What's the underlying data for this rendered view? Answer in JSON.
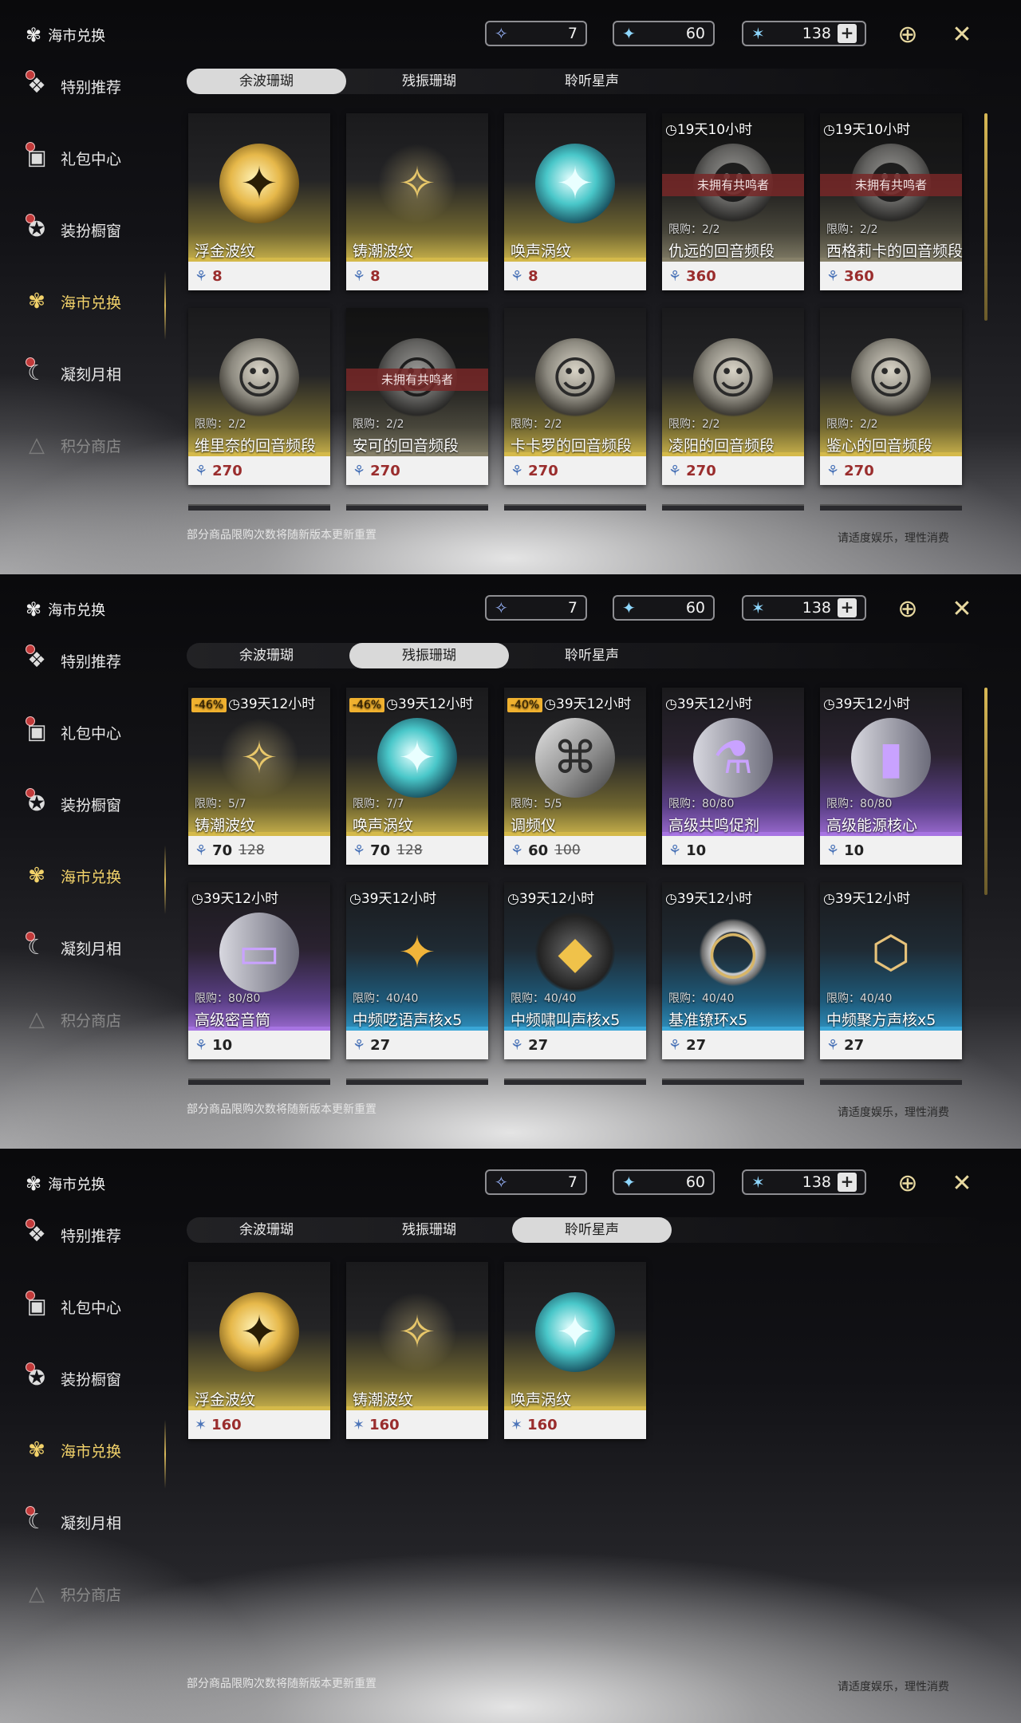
{
  "screens": [
    {
      "header": {
        "title": "海市兑换"
      },
      "sidebar": [
        {
          "label": "特别推荐",
          "badge": true,
          "active": false,
          "dim": false,
          "icon": "star-pack-icon"
        },
        {
          "label": "礼包中心",
          "badge": true,
          "active": false,
          "dim": false,
          "icon": "gift-icon"
        },
        {
          "label": "装扮橱窗",
          "badge": true,
          "active": false,
          "dim": false,
          "icon": "outfit-icon"
        },
        {
          "label": "海市兑换",
          "badge": false,
          "active": true,
          "dim": false,
          "icon": "coral-icon"
        },
        {
          "label": "凝刻月相",
          "badge": true,
          "active": false,
          "dim": false,
          "icon": "moon-icon"
        },
        {
          "label": "积分商店",
          "badge": false,
          "active": false,
          "dim": true,
          "icon": "triangle-icon"
        }
      ],
      "currencies": [
        "7",
        "60",
        "138"
      ],
      "tabs": [
        "余波珊瑚",
        "残振珊瑚",
        "聆听星声"
      ],
      "selected_tab": 0,
      "cards": [
        {
          "title": "浮金波纹",
          "price": "8",
          "style": "gold",
          "item": "orb-gold",
          "glyph": "✦"
        },
        {
          "title": "铸潮波纹",
          "price": "8",
          "style": "gold",
          "item": "orb-blade",
          "glyph": "✧"
        },
        {
          "title": "唤声涡纹",
          "price": "8",
          "style": "gold",
          "item": "orb-teal",
          "glyph": "✦"
        },
        {
          "title": "仇远的回音频段",
          "price": "360",
          "style": "gold",
          "item": "orb-portrait",
          "glyph": "☻",
          "timer": "19天10小时",
          "limit": "限购：2/2",
          "locked": "未拥有共鸣者"
        },
        {
          "title": "西格莉卡的回音频段",
          "price": "360",
          "style": "gold",
          "item": "orb-portrait",
          "glyph": "☻",
          "timer": "19天10小时",
          "limit": "限购：2/2",
          "locked": "未拥有共鸣者"
        },
        {
          "title": "维里奈的回音频段",
          "price": "270",
          "style": "gold",
          "item": "orb-portrait",
          "glyph": "☺",
          "limit": "限购：2/2"
        },
        {
          "title": "安可的回音频段",
          "price": "270",
          "style": "gold",
          "item": "orb-portrait",
          "glyph": "☺",
          "limit": "限购：2/2",
          "locked": "未拥有共鸣者"
        },
        {
          "title": "卡卡罗的回音频段",
          "price": "270",
          "style": "gold",
          "item": "orb-portrait",
          "glyph": "☺",
          "limit": "限购：2/2"
        },
        {
          "title": "凌阳的回音频段",
          "price": "270",
          "style": "gold",
          "item": "orb-portrait",
          "glyph": "☺",
          "limit": "限购：2/2"
        },
        {
          "title": "鉴心的回音频段",
          "price": "270",
          "style": "gold",
          "item": "orb-portrait",
          "glyph": "☺",
          "limit": "限购：2/2"
        }
      ],
      "peek_row": true,
      "footer_left": "部分商品限购次数将随新版本更新重置",
      "footer_right": "请适度娱乐，理性消费"
    },
    {
      "header": {
        "title": "海市兑换"
      },
      "sidebar": [
        {
          "label": "特别推荐",
          "badge": true,
          "active": false,
          "dim": false,
          "icon": "star-pack-icon"
        },
        {
          "label": "礼包中心",
          "badge": true,
          "active": false,
          "dim": false,
          "icon": "gift-icon"
        },
        {
          "label": "装扮橱窗",
          "badge": true,
          "active": false,
          "dim": false,
          "icon": "outfit-icon"
        },
        {
          "label": "海市兑换",
          "badge": false,
          "active": true,
          "dim": false,
          "icon": "coral-icon"
        },
        {
          "label": "凝刻月相",
          "badge": true,
          "active": false,
          "dim": false,
          "icon": "moon-icon"
        },
        {
          "label": "积分商店",
          "badge": false,
          "active": false,
          "dim": true,
          "icon": "triangle-icon"
        }
      ],
      "currencies": [
        "7",
        "60",
        "138"
      ],
      "tabs": [
        "余波珊瑚",
        "残振珊瑚",
        "聆听星声"
      ],
      "selected_tab": 1,
      "cards": [
        {
          "title": "铸潮波纹",
          "price": "70",
          "old": "128",
          "style": "gold",
          "item": "orb-blade",
          "glyph": "✧",
          "timer": "39天12小时",
          "discount": "-46%",
          "limit": "限购：5/7"
        },
        {
          "title": "唤声涡纹",
          "price": "70",
          "old": "128",
          "style": "gold",
          "item": "orb-teal",
          "glyph": "✦",
          "timer": "39天12小时",
          "discount": "-46%",
          "limit": "限购：7/7"
        },
        {
          "title": "调频仪",
          "price": "60",
          "old": "100",
          "style": "gold",
          "item": "orb-device",
          "glyph": "⌘",
          "timer": "39天12小时",
          "discount": "-40%",
          "limit": "限购：5/5"
        },
        {
          "title": "高级共鸣促剂",
          "price": "10",
          "style": "purple",
          "item": "orb-vial",
          "glyph": "⚗",
          "timer": "39天12小时",
          "limit": "限购：80/80"
        },
        {
          "title": "高级能源核心",
          "price": "10",
          "style": "purple",
          "item": "orb-vial",
          "glyph": "▮",
          "timer": "39天12小时",
          "limit": "限购：80/80"
        },
        {
          "title": "高级密音筒",
          "price": "10",
          "style": "purple",
          "item": "orb-vial",
          "glyph": "▭",
          "timer": "39天12小时",
          "limit": "限购：80/80"
        },
        {
          "title": "中频呓语声核x5",
          "price": "27",
          "style": "blue",
          "item": "orb-star",
          "glyph": "✦",
          "timer": "39天12小时",
          "limit": "限购：40/40"
        },
        {
          "title": "中频啸叫声核x5",
          "price": "27",
          "style": "blue",
          "item": "orb-dark",
          "glyph": "◆",
          "timer": "39天12小时",
          "limit": "限购：40/40"
        },
        {
          "title": "基准镣环x5",
          "price": "27",
          "style": "blue",
          "item": "orb-ring",
          "glyph": "◯",
          "timer": "39天12小时",
          "limit": "限购：40/40"
        },
        {
          "title": "中频聚方声核x5",
          "price": "27",
          "style": "blue",
          "item": "orb-hex",
          "glyph": "⬡",
          "timer": "39天12小时",
          "limit": "限购：40/40"
        }
      ],
      "peek_row": true,
      "footer_left": "部分商品限购次数将随新版本更新重置",
      "footer_right": "请适度娱乐，理性消费"
    },
    {
      "header": {
        "title": "海市兑换"
      },
      "sidebar": [
        {
          "label": "特别推荐",
          "badge": true,
          "active": false,
          "dim": false,
          "icon": "star-pack-icon"
        },
        {
          "label": "礼包中心",
          "badge": true,
          "active": false,
          "dim": false,
          "icon": "gift-icon"
        },
        {
          "label": "装扮橱窗",
          "badge": true,
          "active": false,
          "dim": false,
          "icon": "outfit-icon"
        },
        {
          "label": "海市兑换",
          "badge": false,
          "active": true,
          "dim": false,
          "icon": "coral-icon"
        },
        {
          "label": "凝刻月相",
          "badge": true,
          "active": false,
          "dim": false,
          "icon": "moon-icon"
        },
        {
          "label": "积分商店",
          "badge": false,
          "active": false,
          "dim": true,
          "icon": "triangle-icon"
        }
      ],
      "currencies": [
        "7",
        "60",
        "138"
      ],
      "tabs": [
        "余波珊瑚",
        "残振珊瑚",
        "聆听星声"
      ],
      "selected_tab": 2,
      "cards": [
        {
          "title": "浮金波纹",
          "price": "160",
          "style": "gold",
          "item": "orb-gold",
          "glyph": "✦",
          "price_icon": "star"
        },
        {
          "title": "铸潮波纹",
          "price": "160",
          "style": "gold",
          "item": "orb-blade",
          "glyph": "✧",
          "price_icon": "star"
        },
        {
          "title": "唤声涡纹",
          "price": "160",
          "style": "gold",
          "item": "orb-teal",
          "glyph": "✦",
          "price_icon": "star"
        }
      ],
      "peek_row": false,
      "footer_left": "部分商品限购次数将随新版本更新重置",
      "footer_right": "请适度娱乐，理性消费"
    }
  ],
  "icons": {
    "nav": {
      "star-pack-icon": "❖",
      "gift-icon": "▣",
      "outfit-icon": "✪",
      "coral-icon": "✾",
      "moon-icon": "☾",
      "triangle-icon": "△"
    },
    "currency": [
      "✧",
      "✦",
      "✶"
    ],
    "header": "✾",
    "price_coral": "⚘",
    "price_star": "✶",
    "timer": "◷"
  },
  "colors": {
    "accent_gold": "#f2d26a",
    "price_red": "#9a2d2d",
    "discount": "#f0b12f",
    "lock_red": "#782828"
  }
}
